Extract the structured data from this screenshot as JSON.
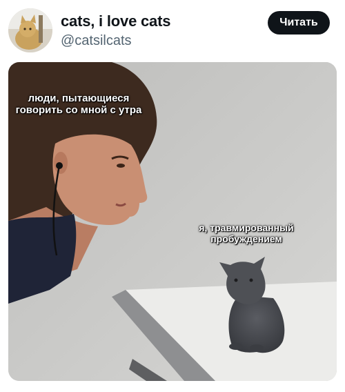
{
  "author": {
    "display_name": "cats, i love cats",
    "handle": "@catsilcats"
  },
  "actions": {
    "read_label": "Читать"
  },
  "meme": {
    "caption_left": "люди, пытающиеся говорить со мной с утра",
    "caption_right": "я, травмированный пробуждением"
  },
  "colors": {
    "button_bg": "#0f1419",
    "handle_text": "#536471",
    "wall": "#c9c9c7",
    "table": "#ececea"
  }
}
